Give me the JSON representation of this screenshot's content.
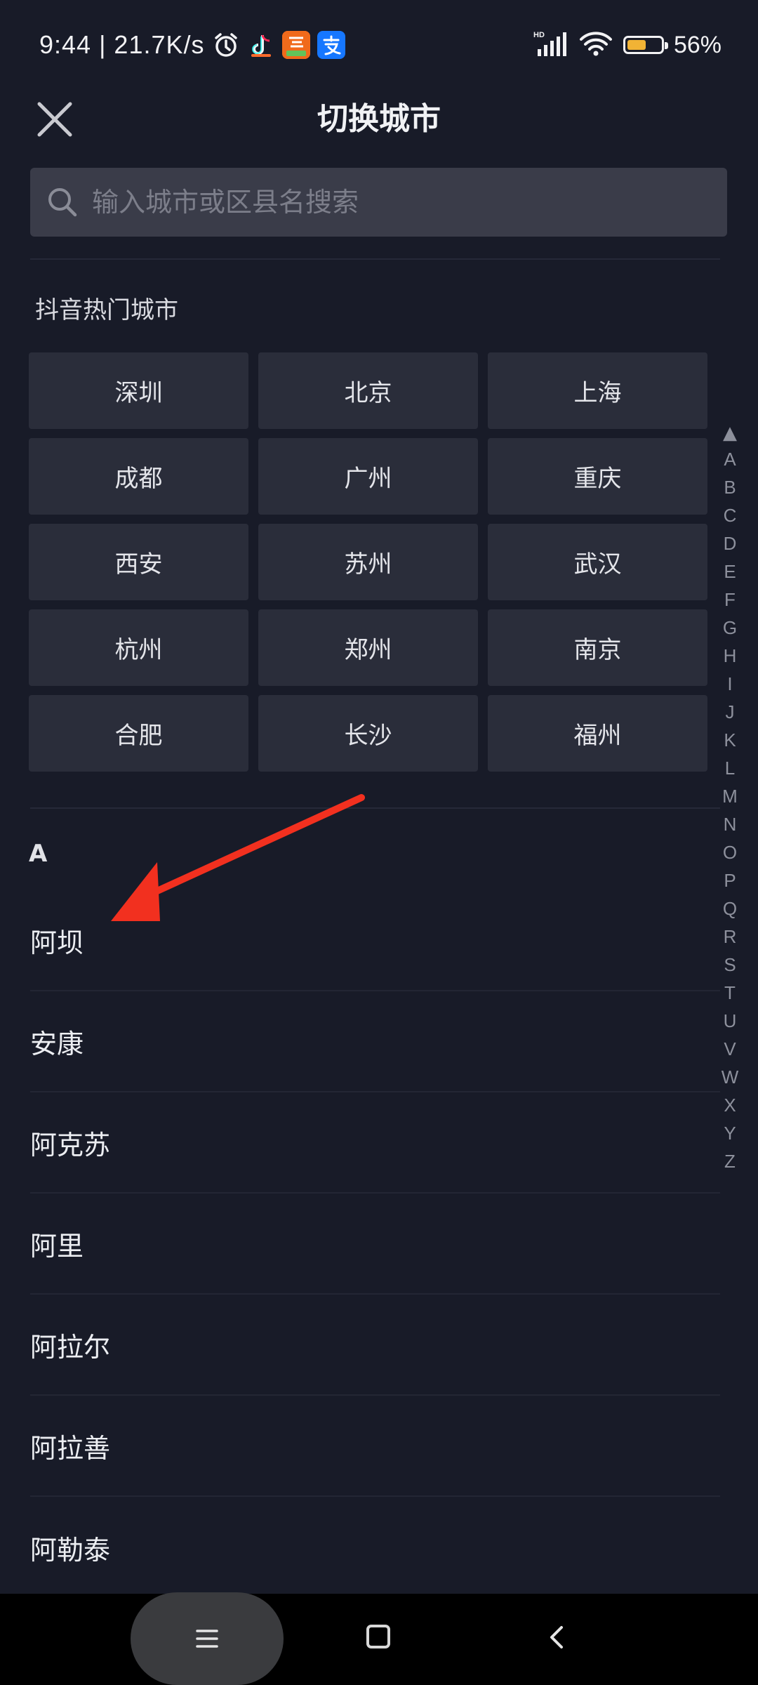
{
  "status_bar": {
    "time_speed": "9:44 | 21.7K/s",
    "network_badge": "HD",
    "battery_level": 56,
    "battery_text": "56%",
    "icons": [
      "alarm-icon",
      "tiktok-icon",
      "taobao-icon",
      "alipay-icon",
      "signal-icon",
      "wifi-icon"
    ],
    "colors": {
      "taobao": "#f06a1b",
      "alipay": "#1677ff",
      "battery_fill": "#f1b335"
    }
  },
  "header": {
    "title": "切换城市"
  },
  "search": {
    "placeholder": "输入城市或区县名搜索",
    "value": ""
  },
  "hot_cities": {
    "title": "抖音热门城市",
    "items": [
      "深圳",
      "北京",
      "上海",
      "成都",
      "广州",
      "重庆",
      "西安",
      "苏州",
      "武汉",
      "杭州",
      "郑州",
      "南京",
      "合肥",
      "长沙",
      "福州"
    ]
  },
  "section": {
    "letter": "A",
    "cities": [
      "阿坝",
      "安康",
      "阿克苏",
      "阿里",
      "阿拉尔",
      "阿拉善",
      "阿勒泰"
    ]
  },
  "alpha_index": {
    "top_symbol": "▲",
    "letters": [
      "A",
      "B",
      "C",
      "D",
      "E",
      "F",
      "G",
      "H",
      "I",
      "J",
      "K",
      "L",
      "M",
      "N",
      "O",
      "P",
      "Q",
      "R",
      "S",
      "T",
      "U",
      "V",
      "W",
      "X",
      "Y",
      "Z"
    ]
  },
  "annotation": {
    "color": "#f2301f"
  },
  "nav_bar": {
    "menu_symbol": "☰"
  }
}
